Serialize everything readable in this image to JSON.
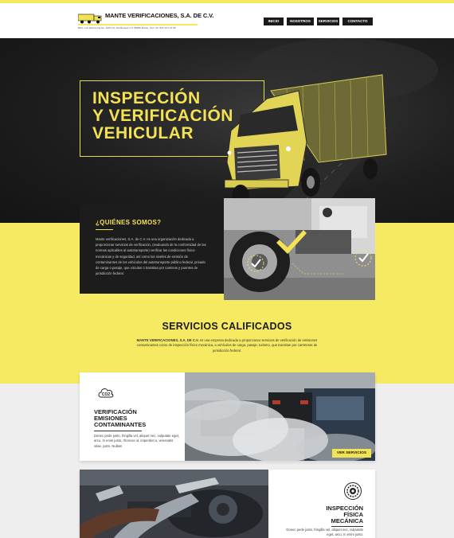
{
  "header": {
    "logo_name": "MANTE VERIFICACIONES, S.A. DE C.V.",
    "logo_sub": "Blvd. Luis Echeverria No. 1105 Col. Del Bosque C.P. 89830 Mante, Tam. Tel. 831 23 2 16 88",
    "nav": [
      {
        "label": "INICIO"
      },
      {
        "label": "NOSOTROS"
      },
      {
        "label": "SERVICIOS"
      },
      {
        "label": "CONTACTO"
      }
    ]
  },
  "hero": {
    "title_lines": [
      "INSPECCIÓN",
      "Y VERIFICACIÓN",
      "VEHICULAR"
    ]
  },
  "about": {
    "title": "¿QUIÉNES SOMOS?",
    "text": "Mante verificaciones, S.A. de C.V. es una organización dedicada a proporcionar servicios de verificación, (evaluando de la conformidad de las normas aplicables al autotransporte) verificar las condiciones físico-mecánicas y de seguridad, así como los niveles de emisión de contaminantes de los vehículos del autotransporte público federal, privado de carga o pasaje, que circulan o transitan por caminos y puentes de jurisdicción federal."
  },
  "services": {
    "title": "SERVICIOS CALIFICADOS",
    "lead_bold": "MANTE VERIFICACIONES, S.A. DE C.V.",
    "lead_text": " es una empresa dedicada a proporcionar servicios de verificación de emisiones contaminantes como de inspección físico mecánica, a vehículos de carga, pasaje, turismo, que transitan por carreteras de jurisdicción federal."
  },
  "card_emisiones": {
    "icon_text": "CO2",
    "title_lines": [
      "VERIFICACIÓN",
      "EMISIONES",
      "CONTAMINANTES"
    ],
    "text": "Donec pede justo, fringilla vel, aliquet nec, vulputate eget, arcu. In enim justo, rhoncus ut, imperdiet a, venenatis vitae, justo. Nullam",
    "button": "VER SERVICIOS"
  },
  "card_fisica": {
    "title_lines": [
      "INSPECCIÓN",
      "FÍSICA",
      "MECÁNICA"
    ],
    "text": "Donec pede justo, fringilla vel, aliquet nec, vulputate eget, arcu. In enim justo."
  },
  "colors": {
    "accent_yellow": "#f3e254",
    "band_yellow": "#f5ea62",
    "dark": "#1c1c1c"
  }
}
